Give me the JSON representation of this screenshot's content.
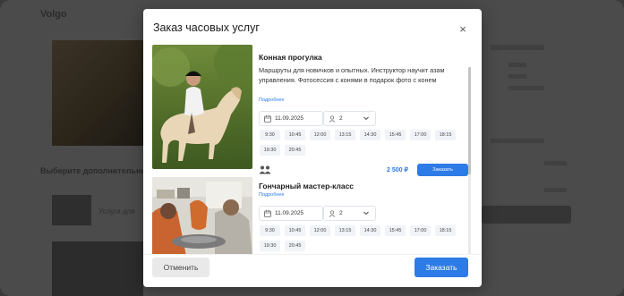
{
  "background": {
    "title": "Volgo",
    "section_title": "Выберите дополнительные услуги",
    "item_text": "Услуги для"
  },
  "modal": {
    "title": "Заказ часовых услуг",
    "close_symbol": "×",
    "cancel_label": "Отменить",
    "submit_label": "Заказать"
  },
  "services": [
    {
      "name": "Конная прогулка",
      "description": "Маршруты для новичков и опытных. Инструктор научит азам управления. Фотосессия с конями в подарок фото с конем",
      "details_label": "Подробнее",
      "date": "11.09.2025",
      "guests": "2",
      "slots": [
        "9:30",
        "10:45",
        "12:00",
        "13:15",
        "14:30",
        "15:45",
        "17:00",
        "18:15",
        "19:30",
        "20:45"
      ],
      "price": "2 500 ₽",
      "order_label": "Заказать"
    },
    {
      "name": "Гончарный мастер-класс",
      "details_label": "Подробнее",
      "date": "11.09.2025",
      "guests": "2",
      "slots": [
        "9:30",
        "10:45",
        "12:00",
        "13:15",
        "14:30",
        "15:45",
        "17:00",
        "18:15",
        "19:30",
        "20:45"
      ]
    }
  ],
  "colors": {
    "accent": "#2d7be6",
    "overlay": "#4b4b4b",
    "slot_bg": "#f0f3f7"
  },
  "icons": [
    "close-icon",
    "calendar-icon",
    "user-icon",
    "chevron-down-icon",
    "people-icon"
  ]
}
